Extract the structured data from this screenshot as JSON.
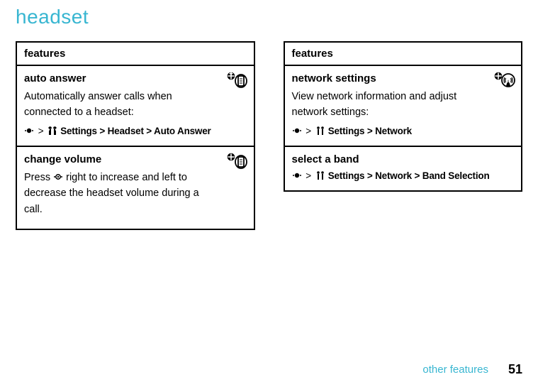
{
  "title": "headset",
  "left": {
    "header": "features",
    "rows": [
      {
        "title": "auto answer",
        "body": "Automatically answer calls when connected to a headset:",
        "path_settings": "Settings",
        "path_rest": " > Headset > Auto Answer"
      },
      {
        "title": "change volume",
        "body_pre": "Press ",
        "body_post": " right to increase and left to decrease the headset volume during a call."
      }
    ]
  },
  "right": {
    "header": "features",
    "rows": [
      {
        "title": "network settings",
        "body": "View network information and adjust network settings:",
        "path_settings": "Settings",
        "path_rest": " > Network"
      },
      {
        "title": "select a band",
        "path_settings": "Settings",
        "path_rest": " > Network > Band Selection"
      }
    ]
  },
  "footer": {
    "text": "other features",
    "page": "51"
  }
}
